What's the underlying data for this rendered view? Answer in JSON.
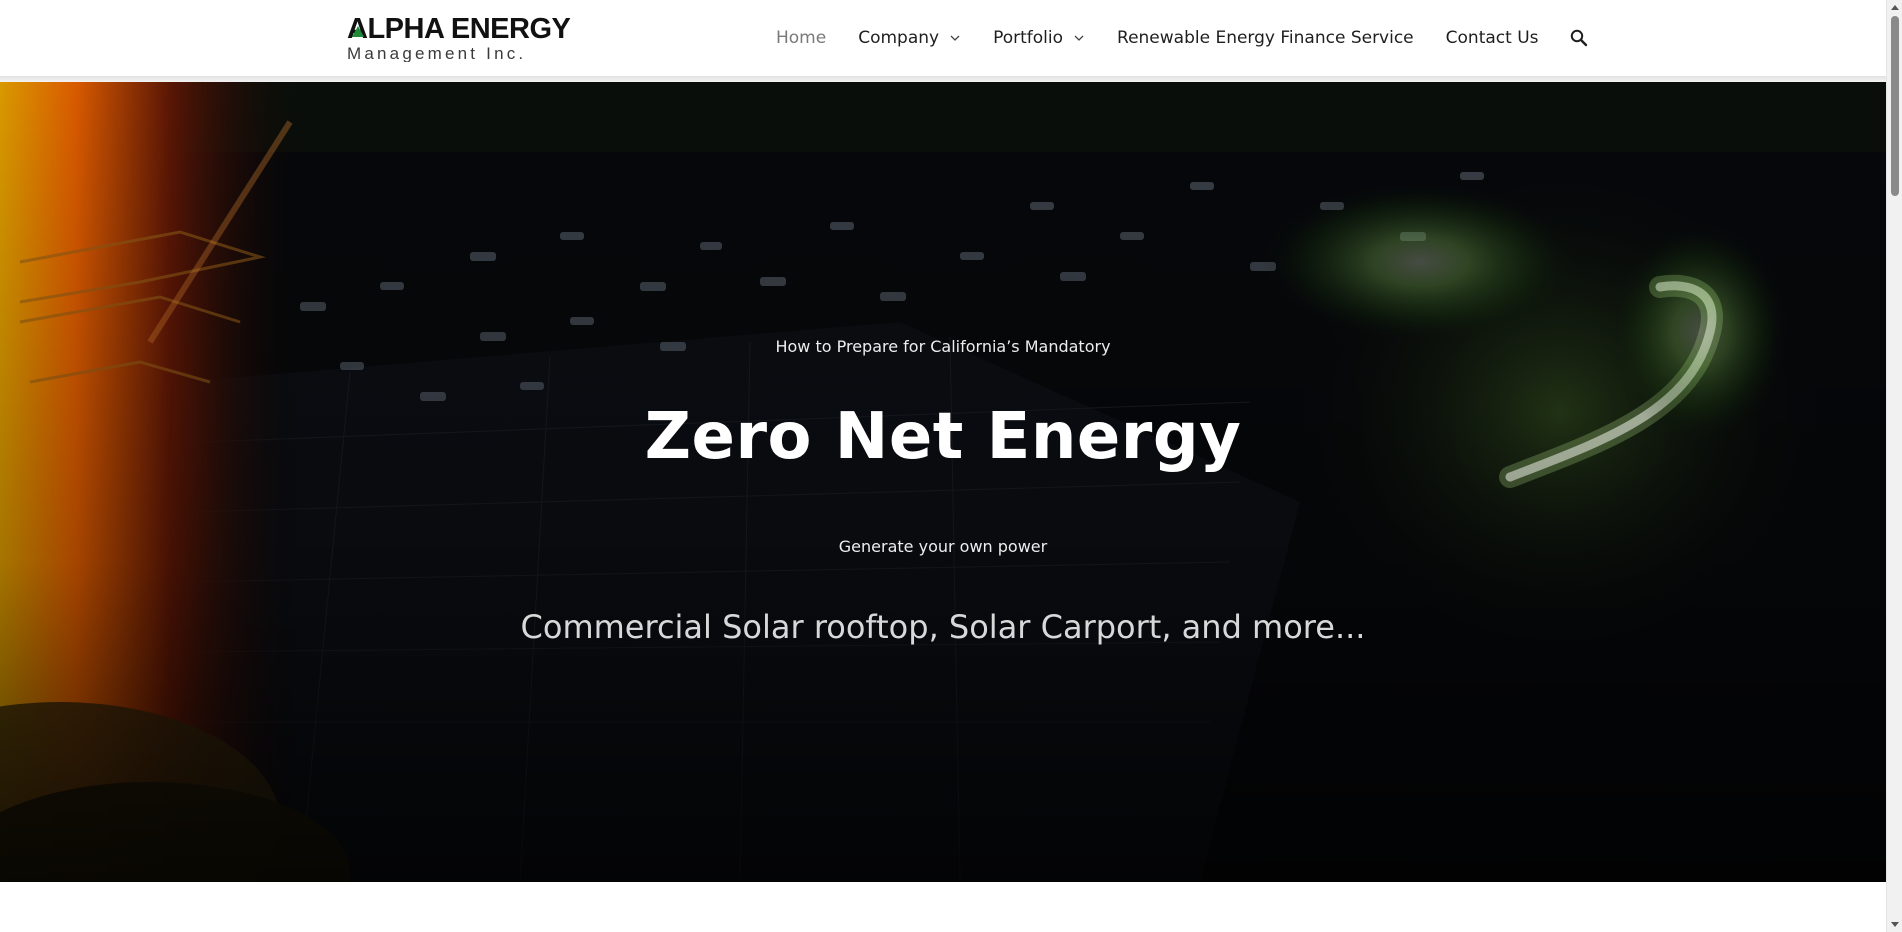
{
  "header": {
    "logo": {
      "line1": "ALPHA ENERGY",
      "line2": "Management Inc."
    },
    "nav": {
      "items": [
        {
          "label": "Home",
          "active": true,
          "has_dropdown": false
        },
        {
          "label": "Company",
          "active": false,
          "has_dropdown": true
        },
        {
          "label": "Portfolio",
          "active": false,
          "has_dropdown": true
        },
        {
          "label": "Renewable Energy Finance Service",
          "active": false,
          "has_dropdown": false
        },
        {
          "label": "Contact Us",
          "active": false,
          "has_dropdown": false
        }
      ],
      "search_icon": "search-icon",
      "dropdown_icon": "chevron-down-icon"
    }
  },
  "hero": {
    "pretitle": "How to Prepare for California’s Mandatory",
    "title": "Zero Net Energy",
    "subtitle": "Generate your own power",
    "tagline": "Commercial Solar rooftop, Solar Carport, and more..."
  },
  "colors": {
    "logo_dark": "#111111",
    "logo_green": "#1f8a3a",
    "nav_text": "#1f1f1f",
    "nav_active": "#7a7a7a",
    "hero_overlay": "#050608"
  }
}
